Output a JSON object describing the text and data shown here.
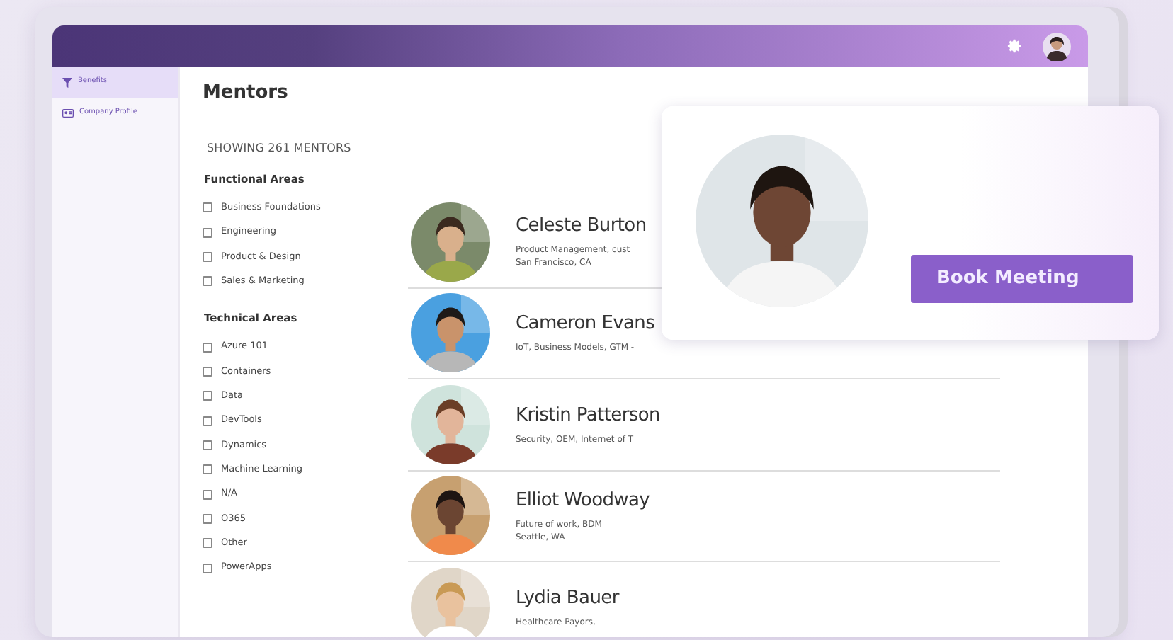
{
  "sidebar": {
    "items": [
      {
        "label": "Benefits",
        "kind": "filter",
        "selected": true
      },
      {
        "label": "Company Profile",
        "kind": "card",
        "selected": false
      }
    ]
  },
  "page": {
    "title": "Mentors",
    "count": "SHOWING 261 MENTORS"
  },
  "filter_groups": [
    {
      "title": "Functional Areas",
      "options": [
        {
          "label": "Business Foundations",
          "checked": false
        },
        {
          "label": "Engineering",
          "checked": false
        },
        {
          "label": "Product & Design",
          "checked": false
        },
        {
          "label": "Sales & Marketing",
          "checked": false
        }
      ]
    },
    {
      "title": "Technical Areas",
      "options": [
        {
          "label": "Azure 101",
          "checked": false
        },
        {
          "label": "Containers",
          "checked": false
        },
        {
          "label": "Data",
          "checked": false
        },
        {
          "label": "DevTools",
          "checked": false
        },
        {
          "label": "Dynamics",
          "checked": false
        },
        {
          "label": "Machine Learning",
          "checked": false
        },
        {
          "label": "N/A",
          "checked": false
        },
        {
          "label": "O365",
          "checked": false
        },
        {
          "label": "Other",
          "checked": false
        },
        {
          "label": "PowerApps",
          "checked": false
        }
      ]
    }
  ],
  "mentors": [
    {
      "name": "Celeste Burton",
      "details": [
        "Product Management, cust",
        "San Francisco, CA"
      ]
    },
    {
      "name": "Cameron Evans",
      "details": [
        "IoT, Business Models, GTM -"
      ]
    },
    {
      "name": "Kristin Patterson",
      "details": [
        "Security, OEM, Internet of T"
      ]
    },
    {
      "name": "Elliot Woodway",
      "details": [
        "Future of work, BDM",
        "Seattle, WA"
      ]
    },
    {
      "name": "Lydia Bauer",
      "details": [
        "Healthcare Payors,"
      ]
    }
  ],
  "popup": {
    "button": "Book Meeting"
  }
}
